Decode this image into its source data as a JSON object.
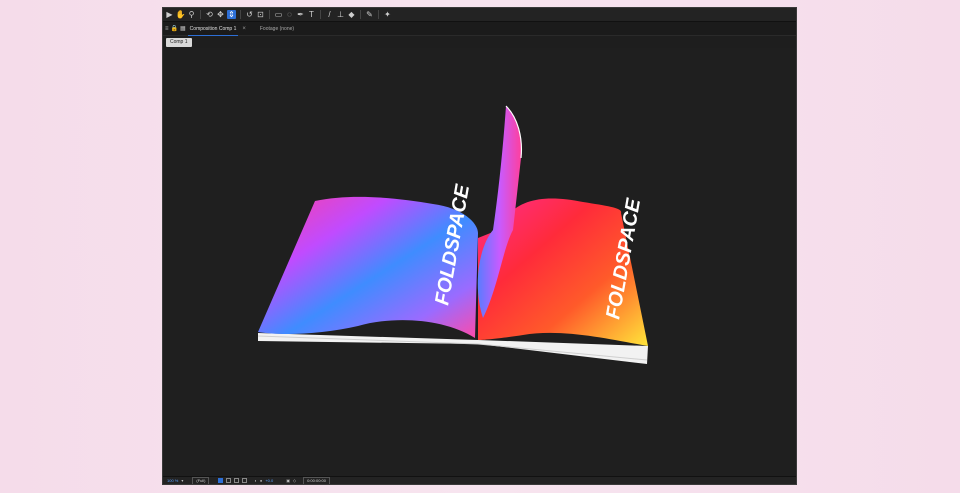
{
  "toolbar": {
    "tools": [
      {
        "name": "selection-tool-icon",
        "glyph": "▶"
      },
      {
        "name": "hand-tool-icon",
        "glyph": "✋"
      },
      {
        "name": "zoom-tool-icon",
        "glyph": "🔍"
      },
      {
        "name": "orbit-camera-icon",
        "glyph": "⟲"
      },
      {
        "name": "pan-camera-icon",
        "glyph": "✥"
      },
      {
        "name": "dolly-camera-icon",
        "glyph": "⇕"
      },
      {
        "name": "rotate-tool-icon",
        "glyph": "↺"
      },
      {
        "name": "anchor-point-icon",
        "glyph": "⊕"
      },
      {
        "name": "rectangle-tool-icon",
        "glyph": "▭"
      },
      {
        "name": "pen-tool-icon",
        "glyph": "✒"
      },
      {
        "name": "type-tool-icon",
        "glyph": "T"
      },
      {
        "name": "brush-tool-icon",
        "glyph": "/"
      },
      {
        "name": "clone-stamp-icon",
        "glyph": "⊥"
      },
      {
        "name": "eraser-tool-icon",
        "glyph": "◆"
      },
      {
        "name": "roto-brush-icon",
        "glyph": "✎"
      },
      {
        "name": "puppet-pin-icon",
        "glyph": "✦"
      }
    ]
  },
  "tabs": {
    "composition_label": "Composition Comp 1",
    "close_glyph": "×",
    "footage_label": "Footage (none)"
  },
  "subbar": {
    "comp_name": "Comp 1"
  },
  "viewer": {
    "left_page_text": "FOLDSPACE",
    "right_page_text": "FOLDSPACE"
  },
  "bottombar": {
    "zoom": "100 %",
    "resolution": "(Full)",
    "exposure": "+0.0",
    "timecode": "0:00:00:00"
  }
}
